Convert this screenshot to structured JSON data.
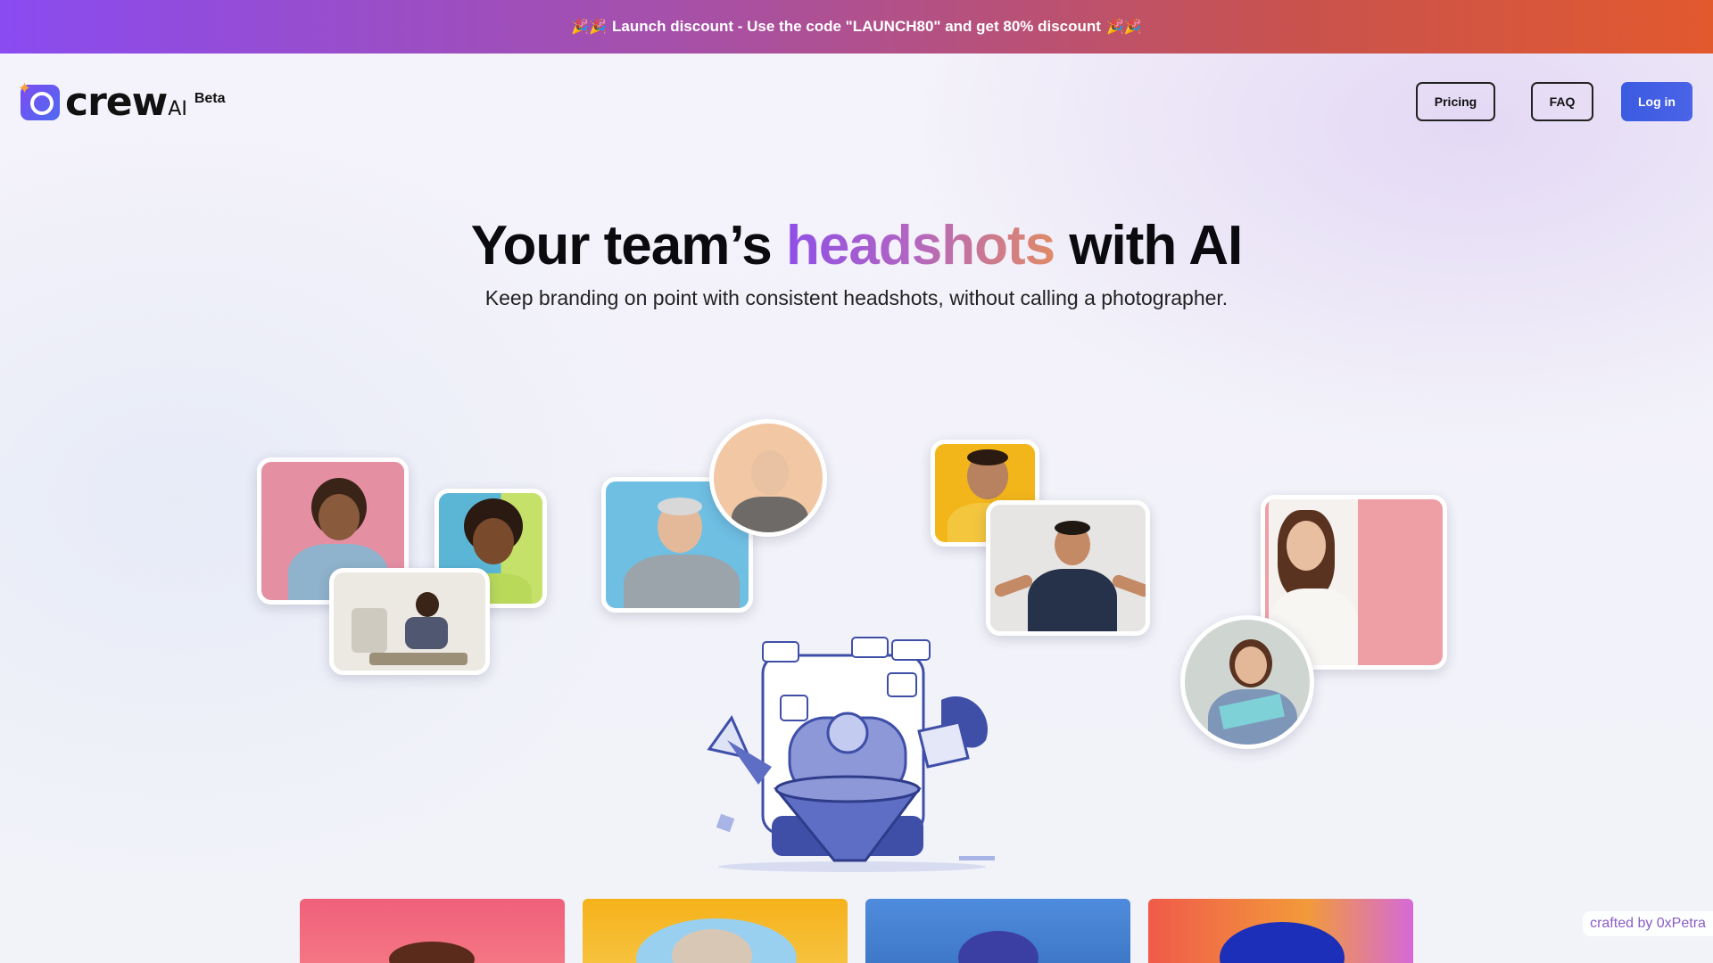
{
  "banner": {
    "text": "Launch discount - Use the code \"LAUNCH80\" and get 80% discount",
    "icon": "party-popper-icon"
  },
  "brand": {
    "name": "crew",
    "suffix": "AI",
    "badge": "Beta"
  },
  "nav": {
    "pricing": "Pricing",
    "faq": "FAQ",
    "login": "Log in"
  },
  "hero": {
    "title_before": "Your team’s",
    "title_highlight": "headshots",
    "title_after": "with AI",
    "subtitle": "Keep branding on point with consistent headshots, without calling a photographer."
  },
  "colors": {
    "accent_blue": "#3b5be0",
    "gradient_purple": "#8e4fe6",
    "gradient_orange": "#e08a66",
    "banner_start": "#8a4bf0",
    "banner_end": "#e2592e"
  },
  "footer_credit": "crafted by 0xPetra"
}
